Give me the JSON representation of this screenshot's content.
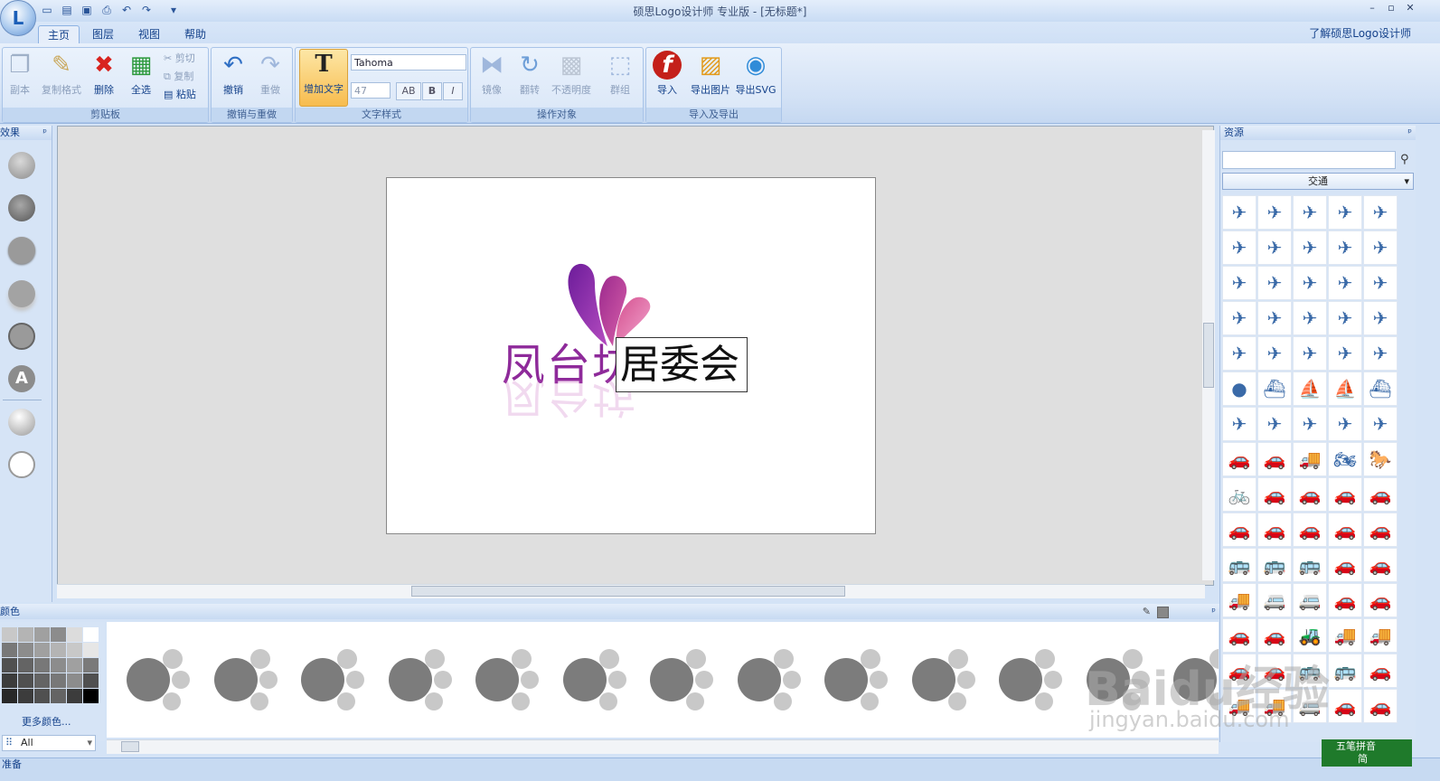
{
  "window": {
    "title": "硕思Logo设计师 专业版 - [无标题*]"
  },
  "menu_tabs": [
    {
      "label": "主页",
      "active": true
    },
    {
      "label": "图层",
      "active": false
    },
    {
      "label": "视图",
      "active": false
    },
    {
      "label": "帮助",
      "active": false
    }
  ],
  "about_link": "了解硕思Logo设计师",
  "ribbon": {
    "clipboard": {
      "label": "剪贴板",
      "copy_doc": "副本",
      "format_painter": "复制格式",
      "delete": "删除",
      "select_all": "全选",
      "cut": "剪切",
      "copy": "复制",
      "paste": "粘贴"
    },
    "undo_redo": {
      "label": "撤销与重做",
      "undo": "撤销",
      "redo": "重做"
    },
    "text_style": {
      "label": "文字样式",
      "add_text": "增加文字",
      "font": "Tahoma",
      "size": "47",
      "bold": "B",
      "italic": "I",
      "spacing": "AB"
    },
    "operate": {
      "label": "操作对象",
      "mirror": "镜像",
      "rotate": "翻转",
      "opacity": "不透明度",
      "group": "群组"
    },
    "import_export": {
      "label": "导入及导出",
      "import": "导入",
      "export_image": "导出图片",
      "export_svg": "导出SVG"
    }
  },
  "effects_panel": {
    "title": "效果"
  },
  "canvas": {
    "logo_text": "凤台坊",
    "text_box": "居委会"
  },
  "resources_panel": {
    "title": "资源",
    "search_value": "",
    "category": "交通"
  },
  "colors_panel": {
    "title": "颜色",
    "more_colors": "更多颜色...",
    "filter": "All"
  },
  "statusbar": {
    "text": "准备"
  },
  "ime": {
    "label": "五笔拼音",
    "mode": "简"
  },
  "watermark": {
    "text": "Baidu经验",
    "url": "jingyan.baidu.com"
  },
  "colors": {
    "accent": "#15428b",
    "logo_purple": "#8e2a9a",
    "logo_pink": "#d6549e"
  }
}
